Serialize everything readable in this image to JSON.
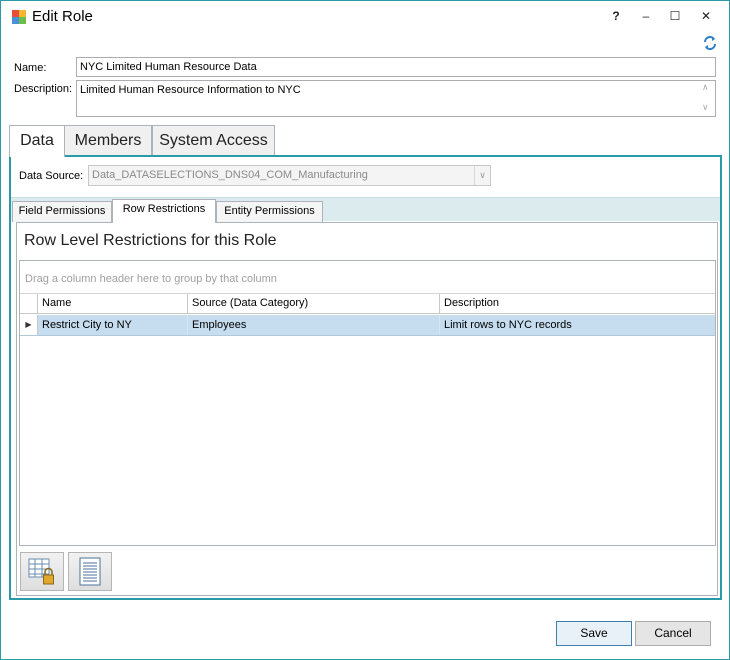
{
  "window": {
    "title": "Edit Role",
    "controls": {
      "help": "?",
      "minimize": "–",
      "maximize": "☐",
      "close": "✕"
    }
  },
  "form": {
    "name_label": "Name:",
    "name_value": "NYC Limited Human Resource Data",
    "description_label": "Description:",
    "description_value": "Limited Human Resource Information to NYC"
  },
  "main_tabs": [
    {
      "label": "Data",
      "active": true
    },
    {
      "label": "Members",
      "active": false
    },
    {
      "label": "System Access",
      "active": false
    }
  ],
  "data_source": {
    "label": "Data Source:",
    "value": "Data_DATASELECTIONS_DNS04_COM_Manufacturing",
    "arrow": "∨"
  },
  "sub_tabs": [
    {
      "label": "Field Permissions",
      "active": false
    },
    {
      "label": "Row Restrictions",
      "active": true
    },
    {
      "label": "Entity Permissions",
      "active": false
    }
  ],
  "section": {
    "title": "Row Level Restrictions for this Role",
    "group_hint": "Drag a column header here to group by that column"
  },
  "grid": {
    "columns": [
      "Name",
      "Source (Data Category)",
      "Description"
    ],
    "rows": [
      {
        "indicator": "▶",
        "name": "Restrict City to NY",
        "source": "Employees",
        "description": "Limit rows to NYC records",
        "selected": true
      }
    ]
  },
  "buttons": {
    "save": "Save",
    "cancel": "Cancel"
  },
  "colors": {
    "accent": "#2b9aa8",
    "selection": "#c5ddef",
    "subtab_strip": "#dcebee"
  }
}
